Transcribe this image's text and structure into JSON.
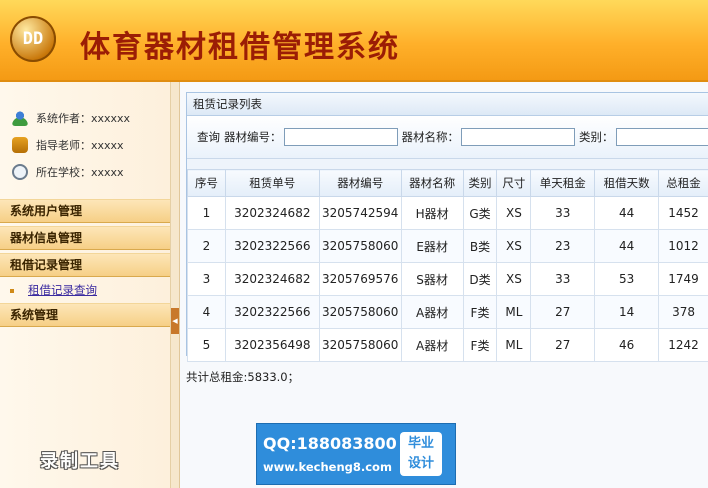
{
  "header": {
    "logo_text": "DD",
    "title": "体育器材租借管理系统"
  },
  "sidebar": {
    "info": [
      {
        "icon": "user-icon",
        "text": "系统作者：xxxxxx"
      },
      {
        "icon": "teacher-icon",
        "text": "指导老师：xxxxx"
      },
      {
        "icon": "school-icon",
        "text": "所在学校：xxxxx"
      }
    ],
    "menu": {
      "user_mgmt": "系统用户管理",
      "equip_mgmt": "器材信息管理",
      "rental_mgmt": "租借记录管理",
      "rental_query": "租借记录查询",
      "sys_mgmt": "系统管理"
    }
  },
  "panel": {
    "title": "租赁记录列表",
    "search": {
      "query_label": "查询",
      "code_label": "器材编号：",
      "code_value": "",
      "name_label": "器材名称：",
      "name_value": "",
      "type_label": "类别：",
      "type_value": ""
    },
    "table": {
      "headers": [
        "序号",
        "租赁单号",
        "器材编号",
        "器材名称",
        "类别",
        "尺寸",
        "单天租金",
        "租借天数",
        "总租金"
      ],
      "rows": [
        [
          "1",
          "3202324682",
          "3205742594",
          "H器材",
          "G类",
          "XS",
          "33",
          "44",
          "1452"
        ],
        [
          "2",
          "3202322566",
          "3205758060",
          "E器材",
          "B类",
          "XS",
          "23",
          "44",
          "1012"
        ],
        [
          "3",
          "3202324682",
          "3205769576",
          "S器材",
          "D类",
          "XS",
          "33",
          "53",
          "1749"
        ],
        [
          "4",
          "3202322566",
          "3205758060",
          "A器材",
          "F类",
          "ML",
          "27",
          "14",
          "378"
        ],
        [
          "5",
          "3202356498",
          "3205758060",
          "A器材",
          "F类",
          "ML",
          "27",
          "46",
          "1242"
        ]
      ]
    },
    "total_text": "共计总租金:5833.0；"
  },
  "watermark": {
    "qq_line": "QQ:188083800",
    "site": "www.kecheng8.com",
    "badge_line1": "毕业",
    "badge_line2": "设计",
    "rec_stamp": "录制工具"
  }
}
